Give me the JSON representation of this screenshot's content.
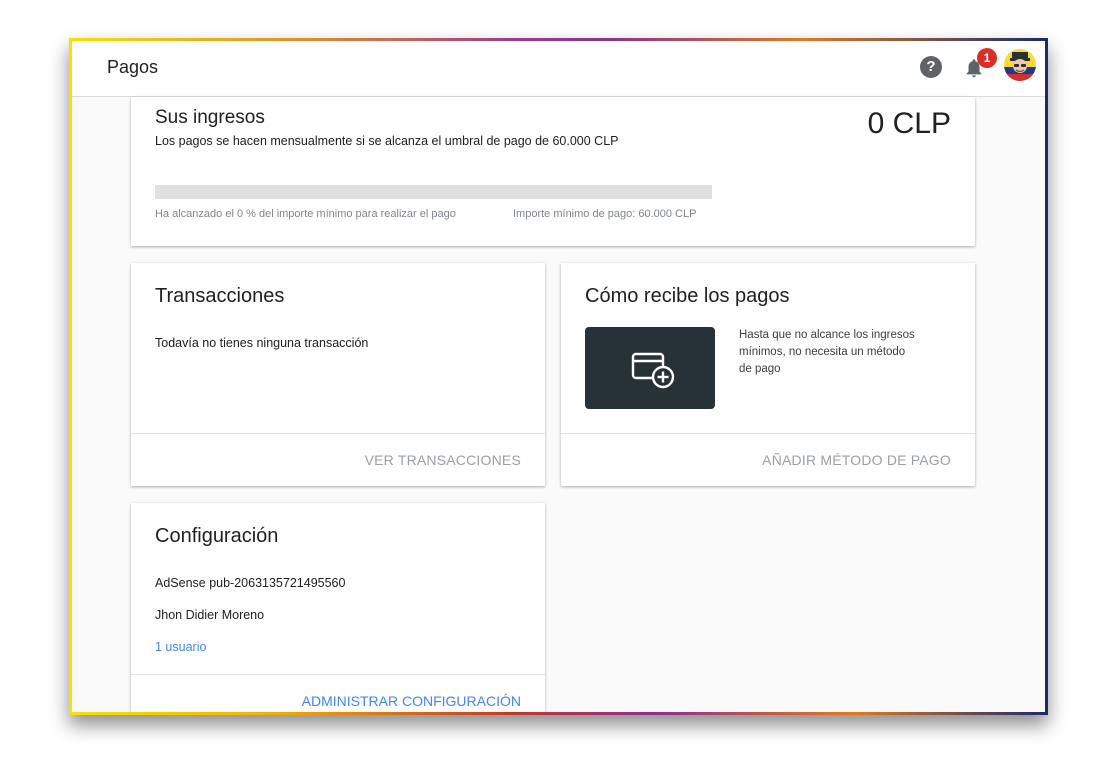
{
  "app": {
    "title": "Pagos",
    "help_icon": "help-icon",
    "notifications": {
      "icon": "bell-icon",
      "count": "1"
    },
    "avatar": "user-avatar"
  },
  "income": {
    "heading": "Sus ingresos",
    "description": "Los pagos se hacen mensualmente si se alcanza el umbral de pago de 60.000 CLP",
    "amount": "0 CLP",
    "progress_percent": 0,
    "progress_note": "Ha alcanzado el 0 % del importe mínimo para realizar el pago",
    "minimum_note": "Importe mínimo de pago: 60.000 CLP"
  },
  "transactions": {
    "heading": "Transacciones",
    "empty_text": "Todavía no tienes ninguna transacción",
    "action": "VER TRANSACCIONES"
  },
  "payment_method": {
    "heading": "Cómo recibe los pagos",
    "icon": "add-card-icon",
    "text_line1": "Hasta que no alcance los ingresos",
    "text_line2": "mínimos, no necesita un método",
    "text_line3": "de pago",
    "action": "AÑADIR MÉTODO DE PAGO"
  },
  "settings": {
    "heading": "Configuración",
    "account_id": "AdSense pub-2063135721495560",
    "account_name": "Jhon Didier Moreno",
    "users_link": "1 usuario",
    "action": "ADMINISTRAR CONFIGURACIÓN"
  },
  "colors": {
    "accent": "#4285f4",
    "badge": "#d93025",
    "thumb_bg": "#263238"
  }
}
